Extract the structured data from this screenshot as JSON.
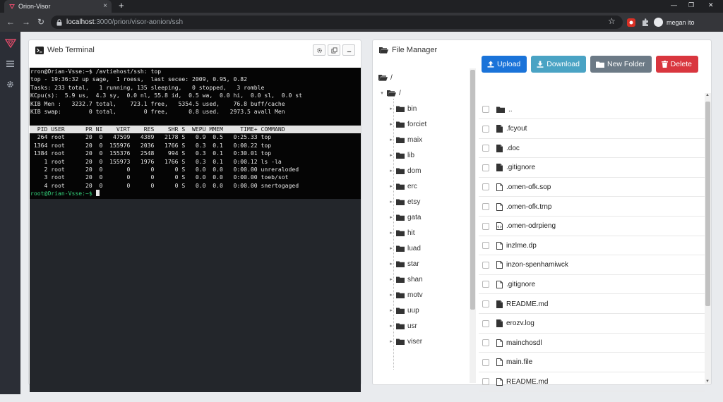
{
  "browser": {
    "tab_title": "Orion-Visor",
    "tab_close": "×",
    "new_tab": "+",
    "window_controls": [
      "—",
      "❐",
      "✕"
    ],
    "url_host": "localhost",
    "url_path": ":3000/prion/visor-aonion/ssh",
    "profile_name": "megan ito"
  },
  "icons": {
    "back": "←",
    "forward": "→",
    "reload": "↻",
    "star": "☆"
  },
  "terminal": {
    "title": "Web Terminal",
    "top_lines": [
      "rron@Orian-Vsse:~$ /avtiehost/ssh: top",
      "top - 19:36:32 up sage,  1 roess,  last secee: 2009, 0.95, 0.82",
      "Tasks: 233 total,   1 running, 135 sleeping,   0 stopped,   3 romble",
      "KCpu(s):  5.9 us,  4.3 sy,  0.0 nl, 55.8 id,  0.5 wa,  0.0 hi,  0.0 sl,  0.0 st",
      "KIB Men :   3232.7 total,    723.1 free,   5354.5 used,    76.8 buff/cache",
      "KIB swap:        0 total,        0 free,      0.8 used.   2973.5 avall Men"
    ],
    "process_header": "  PID USER      PR NI    VIRT    RES    SHR S  WEPU MMEM     TIME+ COMMAND",
    "process_lines": [
      "  264 root      20  0   47599   4389   2178 S   0.9  0.5   0:25.33 top",
      " 1364 root      20  0  155976   2036   1766 S   0.3  0.1   0:00.22 top",
      " 1384 root      20  0  155376   2548    994 S   0.3  0.1   0:30.01 top",
      "    1 root      20  0  155973   1976   1766 S   0.3  0.1   0:00.12 ls -la",
      "    2 root      20  0       0      0      0 S   0.0  0.0   0:00.00 unreraloded",
      "    3 root      20  0       0      0      0 S   0.0  0.0   0:00.00 toeb/sot",
      "    4 root      20  0       0      0      0 S   0.0  0.0   0:00.00 snertogaged"
    ],
    "prompt": "root@Orian-Vsse:~$ "
  },
  "file_manager": {
    "title": "File Manager",
    "tree_root": "/",
    "tree_sub": "/",
    "tree_items": [
      "bin",
      "forciet",
      "maix",
      "lib",
      "dom",
      "erc",
      "etsy",
      "gata",
      "hit",
      "luad",
      "star",
      "shan",
      "motv",
      "uup",
      "usr",
      "viser"
    ],
    "buttons": {
      "upload": "Upload",
      "download": "Download",
      "new_folder": "New Folder",
      "delete": "Delete"
    },
    "button_colors": {
      "upload": "#1a73d9",
      "download": "#4aa3c4",
      "new_folder": "#6c7a86",
      "delete": "#d9363e"
    },
    "files": [
      {
        "name": "..",
        "icon": "folder-icon"
      },
      {
        "name": ".fcyout",
        "icon": "file-icon"
      },
      {
        "name": ".doc",
        "icon": "file-icon"
      },
      {
        "name": ".gitignore",
        "icon": "file-icon"
      },
      {
        "name": ".omen-ofk.sop",
        "icon": "file-outline-icon"
      },
      {
        "name": ".omen-ofk.trnp",
        "icon": "file-outline-icon"
      },
      {
        "name": ".omen-odrpieng",
        "icon": "file-code-icon"
      },
      {
        "name": "inzlme.dp",
        "icon": "file-outline-icon"
      },
      {
        "name": "inzon-spenhamiwck",
        "icon": "file-outline-icon"
      },
      {
        "name": ".gitignore",
        "icon": "file-outline-icon"
      },
      {
        "name": "README.md",
        "icon": "file-icon"
      },
      {
        "name": "erozv.log",
        "icon": "file-icon"
      },
      {
        "name": "mainchosdl",
        "icon": "file-outline-icon"
      },
      {
        "name": "main.file",
        "icon": "file-outline-icon"
      },
      {
        "name": "README.md",
        "icon": "file-outline-icon"
      }
    ]
  }
}
